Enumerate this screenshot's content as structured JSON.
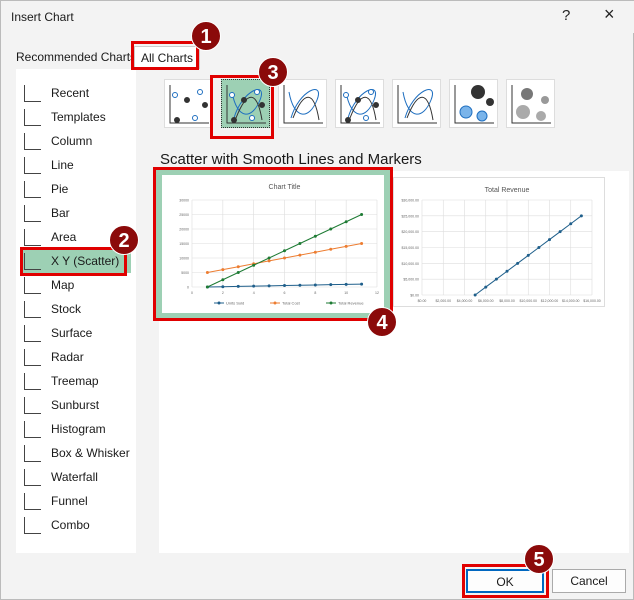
{
  "window": {
    "title": "Insert Chart",
    "help": "?",
    "close": "×"
  },
  "tabs": [
    {
      "label": "Recommended Charts"
    },
    {
      "label": "All Charts"
    }
  ],
  "sidebar": {
    "items": [
      {
        "label": "Recent",
        "icon": "recent-icon"
      },
      {
        "label": "Templates",
        "icon": "folder-icon"
      },
      {
        "label": "Column",
        "icon": "column-chart-icon"
      },
      {
        "label": "Line",
        "icon": "line-chart-icon"
      },
      {
        "label": "Pie",
        "icon": "pie-chart-icon"
      },
      {
        "label": "Bar",
        "icon": "bar-chart-icon"
      },
      {
        "label": "Area",
        "icon": "area-chart-icon"
      },
      {
        "label": "X Y (Scatter)",
        "icon": "scatter-chart-icon",
        "selected": true
      },
      {
        "label": "Map",
        "icon": "map-icon"
      },
      {
        "label": "Stock",
        "icon": "stock-chart-icon"
      },
      {
        "label": "Surface",
        "icon": "surface-chart-icon"
      },
      {
        "label": "Radar",
        "icon": "radar-chart-icon"
      },
      {
        "label": "Treemap",
        "icon": "treemap-icon"
      },
      {
        "label": "Sunburst",
        "icon": "sunburst-icon"
      },
      {
        "label": "Histogram",
        "icon": "histogram-icon"
      },
      {
        "label": "Box & Whisker",
        "icon": "box-whisker-icon"
      },
      {
        "label": "Waterfall",
        "icon": "waterfall-icon"
      },
      {
        "label": "Funnel",
        "icon": "funnel-icon"
      },
      {
        "label": "Combo",
        "icon": "combo-chart-icon"
      }
    ]
  },
  "subtypes": [
    "scatter",
    "scatter-smooth-markers",
    "scatter-smooth",
    "scatter-straight-markers",
    "scatter-straight",
    "bubble",
    "3d-bubble"
  ],
  "subtype_heading": "Scatter with Smooth Lines and Markers",
  "buttons": {
    "ok": "OK",
    "cancel": "Cancel"
  },
  "badges": [
    "1",
    "2",
    "3",
    "4",
    "5"
  ],
  "colors": {
    "units": "#1f5f8b",
    "cost": "#ed7d31",
    "revenue": "#1e7b34",
    "accent": "#e00000",
    "selected": "#9dd0b4"
  },
  "chart_data": [
    {
      "type": "scatter",
      "title": "Chart Title",
      "x": [
        1,
        2,
        3,
        4,
        5,
        6,
        7,
        8,
        9,
        10,
        11
      ],
      "xlim": [
        0,
        12
      ],
      "ylim": [
        0,
        30000
      ],
      "xticks": [
        "0",
        "2",
        "4",
        "6",
        "8",
        "10",
        "12"
      ],
      "yticks": [
        "0",
        "5000",
        "10000",
        "15000",
        "20000",
        "25000",
        "30000"
      ],
      "series": [
        {
          "name": "Units Sold",
          "values": [
            0,
            100,
            200,
            300,
            400,
            500,
            600,
            700,
            800,
            900,
            1000
          ]
        },
        {
          "name": "Total Cost",
          "values": [
            5000,
            6000,
            7000,
            8000,
            9000,
            10000,
            11000,
            12000,
            13000,
            14000,
            15000
          ]
        },
        {
          "name": "Total Revenue",
          "values": [
            0,
            2500,
            5000,
            7500,
            10000,
            12500,
            15000,
            17500,
            20000,
            22500,
            25000
          ]
        }
      ]
    },
    {
      "type": "scatter",
      "title": "Total Revenue",
      "x": [
        5000,
        6000,
        7000,
        8000,
        9000,
        10000,
        11000,
        12000,
        13000,
        14000,
        15000
      ],
      "values": [
        0,
        2500,
        5000,
        7500,
        10000,
        12500,
        15000,
        17500,
        20000,
        22500,
        25000
      ],
      "xlim": [
        0,
        16000
      ],
      "ylim": [
        0,
        30000
      ],
      "xticks": [
        "$0.00",
        "$2,000.00",
        "$4,000.00",
        "$6,000.00",
        "$8,000.00",
        "$10,000.00",
        "$12,000.00",
        "$14,000.00",
        "$16,000.00"
      ],
      "yticks": [
        "$0.00",
        "$5,000.00",
        "$10,000.00",
        "$15,000.00",
        "$20,000.00",
        "$25,000.00",
        "$30,000.00"
      ]
    }
  ]
}
